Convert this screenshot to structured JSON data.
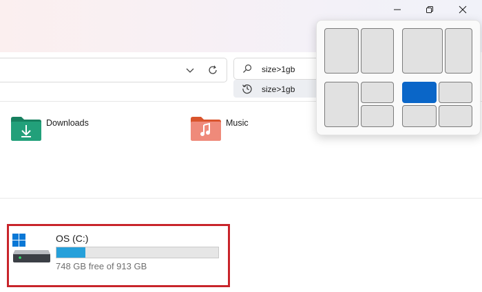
{
  "window": {
    "controls": [
      {
        "name": "minimize-button",
        "icon": "minimize-icon"
      },
      {
        "name": "restore-button",
        "icon": "restore-icon"
      },
      {
        "name": "close-button",
        "icon": "close-icon"
      }
    ]
  },
  "address_bar": {
    "icons": [
      "chevron-down-icon",
      "refresh-icon"
    ]
  },
  "search": {
    "query": "size>1gb",
    "icon": "search-icon",
    "suggestion": {
      "text": "size>1gb",
      "icon": "history-icon"
    }
  },
  "folders": [
    {
      "label": "Downloads",
      "icon": "downloads-folder-icon",
      "color": "#1e8f6e"
    },
    {
      "label": "Music",
      "icon": "music-folder-icon",
      "color": "#e0653d"
    }
  ],
  "drive": {
    "name": "OS (C:)",
    "free_text": "748 GB free of 913 GB",
    "used_fraction": 0.18,
    "bar_color": "#26a0da",
    "icon": "windows-drive-icon",
    "highlight_color": "#c8242a"
  },
  "snap_layouts": {
    "accent": "#0a66c8",
    "layouts": [
      {
        "name": "two-equal-columns",
        "zones": 2
      },
      {
        "name": "wide-narrow-columns",
        "zones": 2
      },
      {
        "name": "left-column-right-stacked",
        "zones": 3
      },
      {
        "name": "four-quadrants",
        "zones": 4,
        "active_zone": "top-left"
      }
    ]
  }
}
